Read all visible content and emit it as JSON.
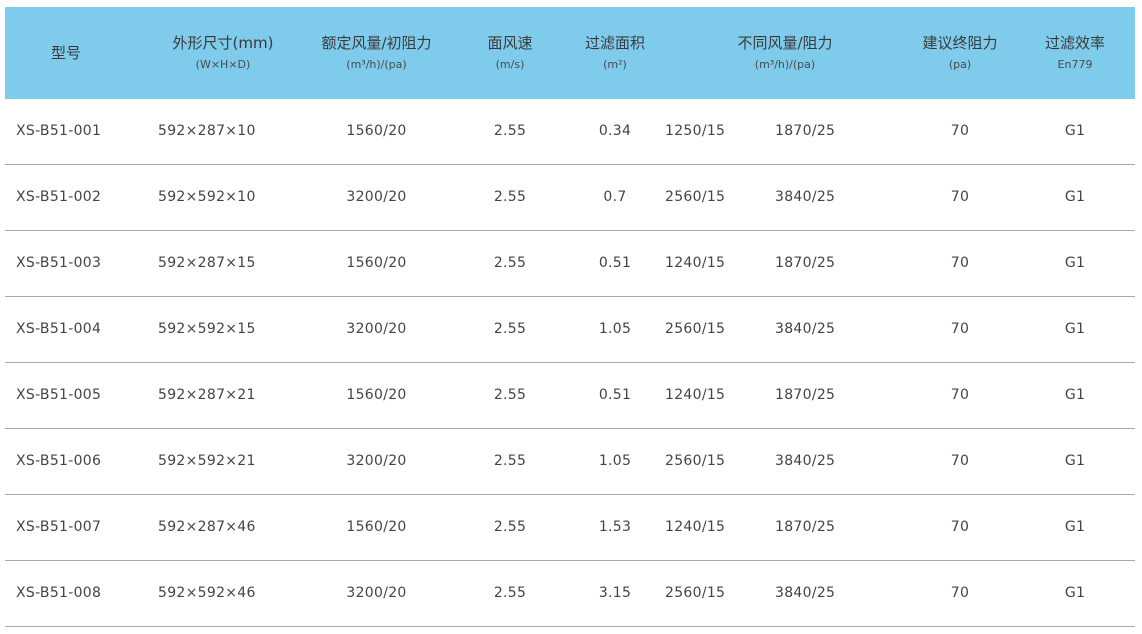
{
  "header": {
    "model": "型号",
    "size": "外形尺寸(mm)",
    "size_sub": "(W×H×D)",
    "rated": "额定风量/初阻力",
    "rated_sub": "(m³/h)/(pa)",
    "velocity": "面风速",
    "velocity_sub": "(m/s)",
    "area": "过滤面积",
    "area_sub": "(m²)",
    "airflow": "不同风量/阻力",
    "airflow_sub": "(m³/h)/(pa)",
    "final_res": "建议终阻力",
    "final_res_sub": "(pa)",
    "efficiency": "过滤效率",
    "efficiency_sub": "En779"
  },
  "rows": [
    {
      "model": "XS-B51-001",
      "size": "592×287×10",
      "rated": "1560/20",
      "velocity": "2.55",
      "area": "0.34",
      "af1": "1250/15",
      "af2": "1870/25",
      "final_res": "70",
      "efficiency": "G1"
    },
    {
      "model": "XS-B51-002",
      "size": "592×592×10",
      "rated": "3200/20",
      "velocity": "2.55",
      "area": "0.7",
      "af1": "2560/15",
      "af2": "3840/25",
      "final_res": "70",
      "efficiency": "G1"
    },
    {
      "model": "XS-B51-003",
      "size": "592×287×15",
      "rated": "1560/20",
      "velocity": "2.55",
      "area": "0.51",
      "af1": "1240/15",
      "af2": "1870/25",
      "final_res": "70",
      "efficiency": "G1"
    },
    {
      "model": "XS-B51-004",
      "size": "592×592×15",
      "rated": "3200/20",
      "velocity": "2.55",
      "area": "1.05",
      "af1": "2560/15",
      "af2": "3840/25",
      "final_res": "70",
      "efficiency": "G1"
    },
    {
      "model": "XS-B51-005",
      "size": "592×287×21",
      "rated": "1560/20",
      "velocity": "2.55",
      "area": "0.51",
      "af1": "1240/15",
      "af2": "1870/25",
      "final_res": "70",
      "efficiency": "G1"
    },
    {
      "model": "XS-B51-006",
      "size": "592×592×21",
      "rated": "3200/20",
      "velocity": "2.55",
      "area": "1.05",
      "af1": "2560/15",
      "af2": "3840/25",
      "final_res": "70",
      "efficiency": "G1"
    },
    {
      "model": "XS-B51-007",
      "size": "592×287×46",
      "rated": "1560/20",
      "velocity": "2.55",
      "area": "1.53",
      "af1": "1240/15",
      "af2": "1870/25",
      "final_res": "70",
      "efficiency": "G1"
    },
    {
      "model": "XS-B51-008",
      "size": "592×592×46",
      "rated": "3200/20",
      "velocity": "2.55",
      "area": "3.15",
      "af1": "2560/15",
      "af2": "3840/25",
      "final_res": "70",
      "efficiency": "G1"
    }
  ],
  "colors": {
    "header_bg": "#7fcbec",
    "row_divider": "#a9a9a9",
    "text": "#444444"
  }
}
